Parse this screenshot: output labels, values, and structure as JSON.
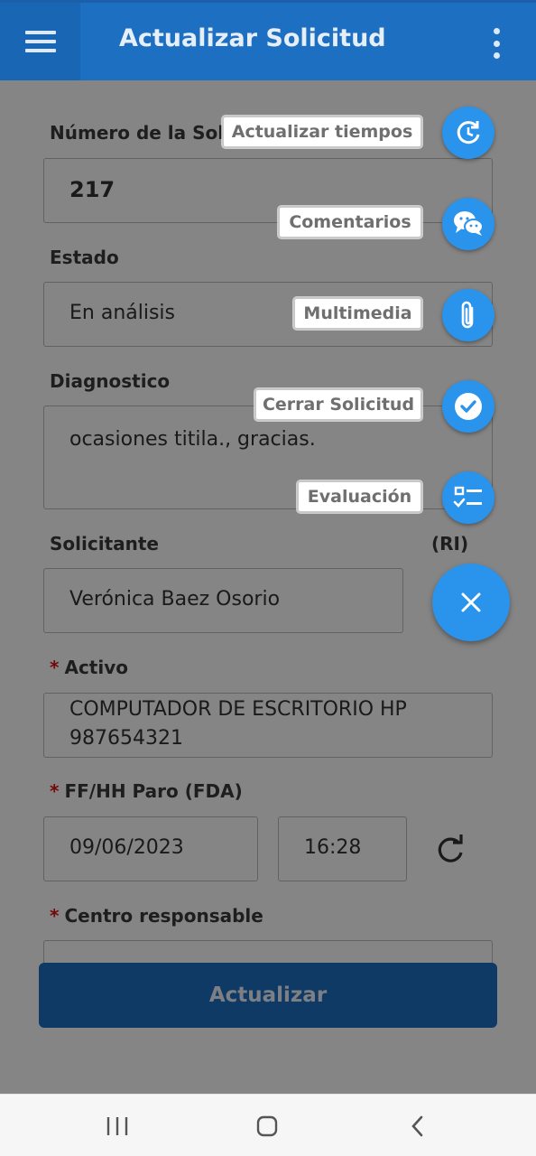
{
  "appbar": {
    "title": "Actualizar Solicitud"
  },
  "form": {
    "numero": {
      "label": "Número de la Solic",
      "value": "217"
    },
    "estado": {
      "label": "Estado",
      "value": "En análisis"
    },
    "diagnostico": {
      "label": "Diagnostico",
      "value": "ocasiones titila., gracias."
    },
    "solicitante": {
      "label": "Solicitante",
      "value": "Verónica Baez Osorio",
      "aside": "(RI)"
    },
    "activo": {
      "required": "*",
      "label": "Activo",
      "value_line1": "COMPUTADOR DE ESCRITORIO HP",
      "value_line2": "987654321"
    },
    "paro": {
      "required": "*",
      "label": "FF/HH Paro (FDA)",
      "date": "09/06/2023",
      "time": "16:28"
    },
    "centro": {
      "required": "*",
      "label": "Centro responsable"
    }
  },
  "update_button": {
    "label": "Actualizar"
  },
  "fab_menu": {
    "items": [
      {
        "label": "Actualizar tiempos",
        "icon": "clock-refresh-icon"
      },
      {
        "label": "Comentarios",
        "icon": "chat-bubbles-icon"
      },
      {
        "label": "Multimedia",
        "icon": "paperclip-icon"
      },
      {
        "label": "Cerrar Solicitud",
        "icon": "check-circle-icon"
      },
      {
        "label": "Evaluación",
        "icon": "checklist-icon"
      }
    ],
    "close_icon": "close-icon"
  },
  "colors": {
    "primary": "#1d6fc2",
    "fab": "#2a93ec",
    "required": "#dd1111"
  }
}
